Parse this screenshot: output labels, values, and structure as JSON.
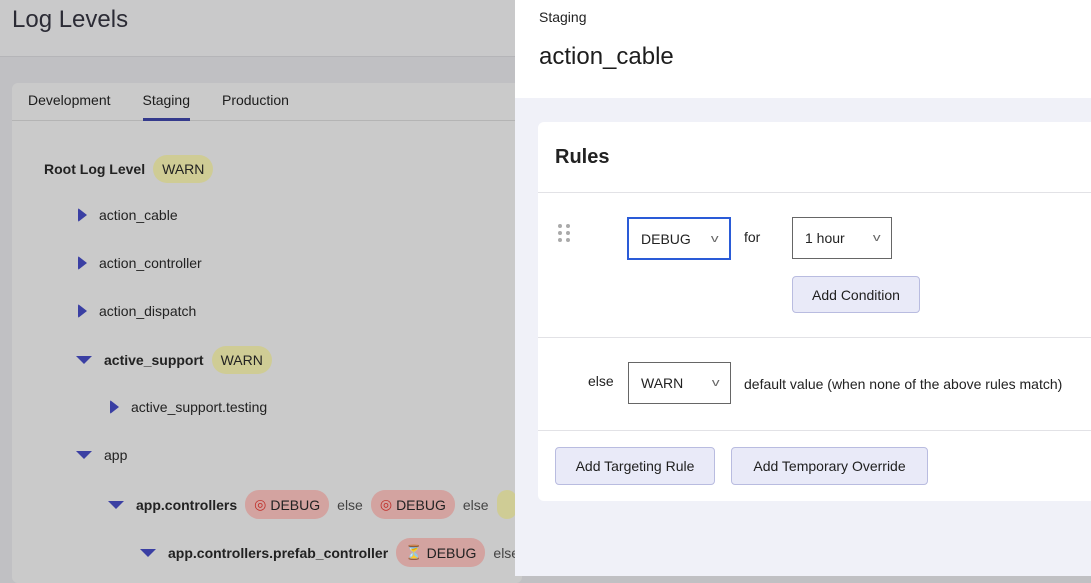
{
  "page": {
    "title": "Log Levels"
  },
  "tabs": [
    {
      "label": "Development"
    },
    {
      "label": "Staging",
      "active": true
    },
    {
      "label": "Production"
    }
  ],
  "tree": {
    "root_label": "Root Log Level",
    "root_level": "WARN",
    "items": [
      {
        "name": "action_cable",
        "state": "collapsed"
      },
      {
        "name": "action_controller",
        "state": "collapsed"
      },
      {
        "name": "action_dispatch",
        "state": "collapsed"
      },
      {
        "name": "active_support",
        "state": "expanded",
        "level": "WARN"
      },
      {
        "name": "active_support.testing",
        "state": "collapsed"
      },
      {
        "name": "app",
        "state": "expanded"
      },
      {
        "name": "app.controllers",
        "state": "expanded",
        "rules": [
          {
            "icon": "target-icon",
            "level": "DEBUG"
          },
          {
            "icon": "target-icon",
            "level": "DEBUG"
          }
        ],
        "else": "else"
      },
      {
        "name": "app.controllers.prefab_controller",
        "state": "expanded",
        "rules": [
          {
            "icon": "hourglass-icon",
            "level": "DEBUG"
          }
        ],
        "else": "else"
      }
    ]
  },
  "panel": {
    "environment": "Staging",
    "config_name": "action_cable",
    "rules_title": "Rules",
    "rule": {
      "level": "DEBUG",
      "for_label": "for",
      "duration": "1 hour",
      "add_condition": "Add Condition"
    },
    "else_row": {
      "else_label": "else",
      "level": "WARN",
      "description": "default value (when none of the above rules match)"
    },
    "add_targeting_rule": "Add Targeting Rule",
    "add_temporary_override": "Add Temporary Override"
  },
  "colors": {
    "accent": "#3a3fa3",
    "warn": "#cfcc95",
    "debug": "#d3a3a0",
    "focus": "#2a5bd7"
  }
}
